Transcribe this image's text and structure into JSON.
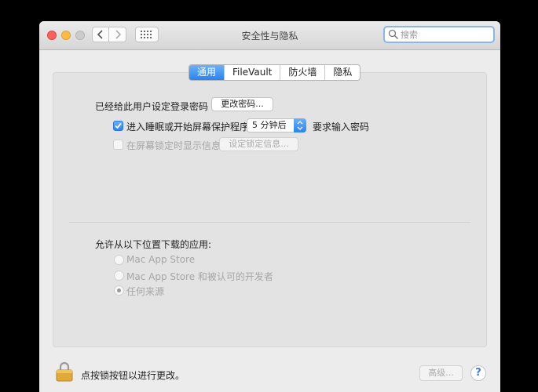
{
  "window": {
    "title": "安全性与隐私",
    "search_placeholder": "搜索",
    "traffic_lights": {
      "close": "#fc605c",
      "minimize": "#fdbc40",
      "zoom": "#cccccc"
    }
  },
  "toolbar": {
    "back_icon": "chevron-left",
    "forward_icon": "chevron-right",
    "grid_icon": "show-all-grid"
  },
  "tabs": [
    {
      "label": "通用",
      "active": true
    },
    {
      "label": "FileVault",
      "active": false
    },
    {
      "label": "防火墙",
      "active": false
    },
    {
      "label": "隐私",
      "active": false
    }
  ],
  "general": {
    "password_set_label": "已经给此用户设定登录密码",
    "change_password_button": "更改密码...",
    "require_password": {
      "checked": true,
      "label_before": "进入睡眠或开始屏幕保护程序",
      "delay_value": "5 分钟后",
      "label_after": "要求输入密码"
    },
    "show_message": {
      "checked": false,
      "label": "在屏幕锁定时显示信息",
      "button": "设定锁定信息..."
    }
  },
  "downloads": {
    "heading": "允许从以下位置下载的应用:",
    "options": [
      {
        "label": "Mac App Store",
        "selected": false
      },
      {
        "label": "Mac App Store 和被认可的开发者",
        "selected": false
      },
      {
        "label": "任何来源",
        "selected": true
      }
    ]
  },
  "footer": {
    "lock_text": "点按锁按钮以进行更改。",
    "advanced_button": "高级...",
    "help_label": "?"
  },
  "colors": {
    "accent": "#2a83ee",
    "disabled_text": "#a6a6a6"
  }
}
